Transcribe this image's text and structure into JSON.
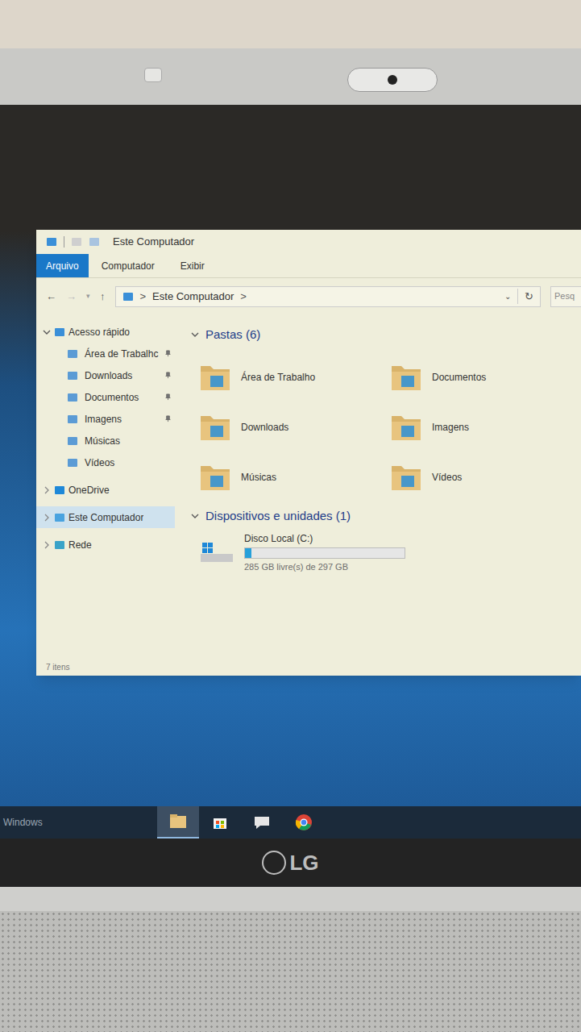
{
  "window": {
    "title": "Este Computador"
  },
  "ribbon": {
    "tabs": [
      {
        "label": "Arquivo",
        "selected": true
      },
      {
        "label": "Computador",
        "selected": false
      },
      {
        "label": "Exibir",
        "selected": false
      }
    ]
  },
  "address": {
    "path": "Este Computador",
    "separator": ">",
    "search": {
      "placeholder": "Pesq"
    }
  },
  "sidebar": {
    "groups": [
      {
        "label": "Acesso rápido",
        "expanded": true,
        "selected": false,
        "children": [
          {
            "label": "Área de Trabalhc",
            "pinned": true,
            "selected": false
          },
          {
            "label": "Downloads",
            "pinned": true,
            "selected": false
          },
          {
            "label": "Documentos",
            "pinned": true,
            "selected": false
          },
          {
            "label": "Imagens",
            "pinned": true,
            "selected": false
          },
          {
            "label": "Músicas",
            "pinned": false,
            "selected": false
          },
          {
            "label": "Vídeos",
            "pinned": false,
            "selected": false
          }
        ]
      },
      {
        "label": "OneDrive",
        "expanded": false,
        "selected": false,
        "children": []
      },
      {
        "label": "Este Computador",
        "expanded": false,
        "selected": true,
        "children": []
      },
      {
        "label": "Rede",
        "expanded": false,
        "selected": false,
        "children": []
      }
    ]
  },
  "folders": {
    "header": "Pastas (6)",
    "expanded": true,
    "items": [
      "Área de Trabalho",
      "Documentos",
      "Downloads",
      "Imagens",
      "Músicas",
      "Vídeos"
    ]
  },
  "devices": {
    "header": "Dispositivos e unidades (1)",
    "expanded": true,
    "items": [
      {
        "name": "Disco Local (C:)",
        "free": "285 GB livre(s) de 297 GB",
        "level": 0.04
      }
    ]
  },
  "status_bar": {
    "text": "7 itens"
  },
  "taskbar": {
    "label": "Windows",
    "apps": [
      {
        "kind": "explorer",
        "selected": true
      },
      {
        "kind": "store",
        "selected": false
      },
      {
        "kind": "chat",
        "selected": false
      },
      {
        "kind": "chrome",
        "selected": false
      }
    ]
  },
  "bezel": {
    "logo": "LG"
  }
}
